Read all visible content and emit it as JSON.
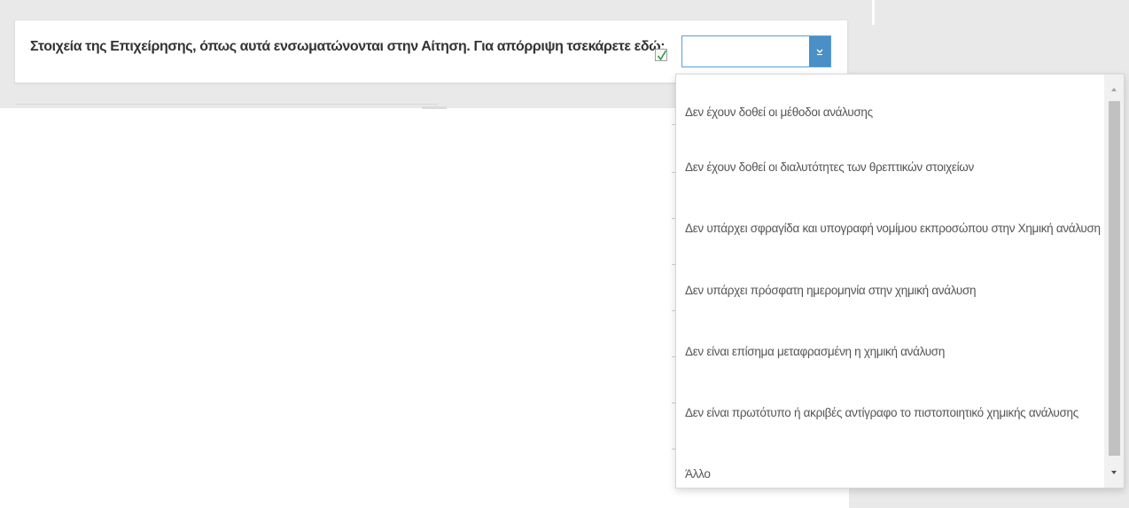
{
  "header": {
    "label": "Στοιχεία της Επιχείρησης, όπως αυτά ενσωματώνονται στην Αίτηση.  Για απόρριψη τσεκάρετε εδώ:",
    "checkbox_checked": true,
    "check_color": "#2e9d3c"
  },
  "select": {
    "value": "",
    "accent_color": "#4a8fc6",
    "arrow_icon": "chevron-down-icon"
  },
  "dropdown": {
    "options": [
      "Δεν έχουν δοθεί οι μέθοδοι ανάλυσης",
      "Δεν έχουν δοθεί οι διαλυτότητες των θρεπτικών στοιχείων",
      "Δεν υπάρχει σφραγίδα και υπογραφή νομίμου εκπροσώπου στην Χημική ανάλυση",
      "Δεν υπάρχει πρόσφατη ημερομηνία στην χημική ανάλυση",
      "Δεν είναι επίσημα μεταφρασμένη η χημική ανάλυση",
      "Δεν είναι πρωτότυπο ή ακριβές αντίγραφο το πιστοποιητικό χημικής ανάλυσης",
      "Άλλο"
    ]
  }
}
